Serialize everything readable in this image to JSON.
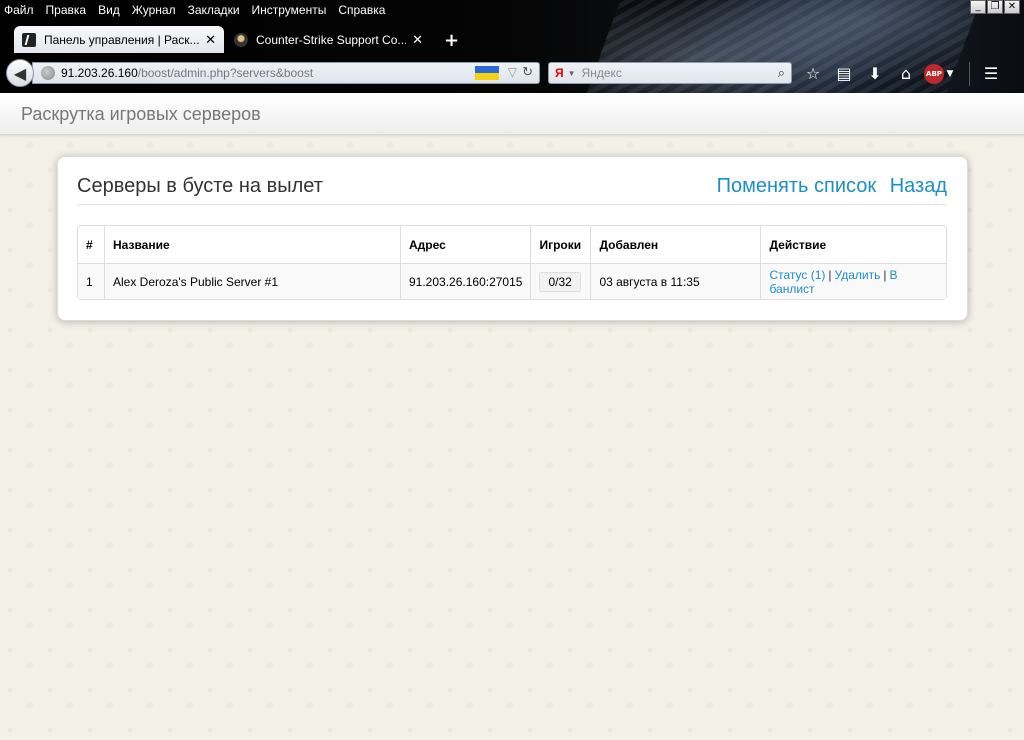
{
  "browser": {
    "menu": [
      "Файл",
      "Правка",
      "Вид",
      "Журнал",
      "Закладки",
      "Инструменты",
      "Справка"
    ],
    "window_controls": [
      "_",
      "❐",
      "✕"
    ],
    "tabs": [
      {
        "title": "Панель управления | Раск...",
        "active": true
      },
      {
        "title": "Counter-Strike Support Co...",
        "active": false
      }
    ],
    "new_tab": "+",
    "url_host": "91.203.26.160",
    "url_path": "/boost/admin.php?servers&boost",
    "search_engine": "Я",
    "search_placeholder": "Яндекс",
    "abp_label": "ABP"
  },
  "site": {
    "brand": "Раскрутка игровых серверов"
  },
  "panel": {
    "title": "Серверы в бусте на вылет",
    "links": [
      "Поменять список",
      "Назад"
    ]
  },
  "table": {
    "headers": [
      "#",
      "Название",
      "Адрес",
      "Игроки",
      "Добавлен",
      "Действие"
    ],
    "rows": [
      {
        "num": "1",
        "name": "Alex Deroza's Public Server #1",
        "address": "91.203.26.160:27015",
        "players": "0/32",
        "added": "03 августа в 11:35",
        "actions": [
          "Статус (1)",
          "Удалить",
          "В банлист"
        ]
      }
    ]
  },
  "colors": {
    "link": "#1b8fc7",
    "page_bg": "#f3f1e8"
  }
}
